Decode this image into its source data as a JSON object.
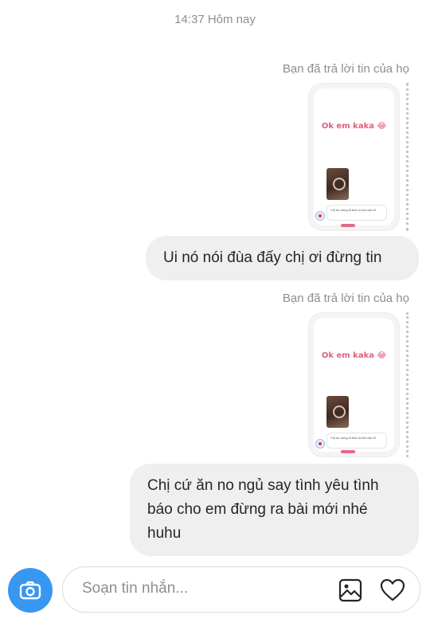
{
  "header": {
    "timestamp": "14:37 Hôm nay"
  },
  "messages": [
    {
      "reply_label": "Bạn đã trả lời tin của họ",
      "story": {
        "title": "Ok em kaka 😂",
        "caption": "Chị ăn uống đi thôi ra bài mới đi"
      },
      "text": "Ui nó nói đùa đấy chị ơi đừng tin"
    },
    {
      "reply_label": "Bạn đã trả lời tin của họ",
      "story": {
        "title": "Ok em kaka 😂",
        "caption": "Chị ăn uống đi thôi ra bài mới đi"
      },
      "text": "Chị cứ ăn no ngủ say tình yêu tình báo cho em đừng ra bài mới nhé huhu"
    }
  ],
  "composer": {
    "placeholder": "Soạn tin nhắn..."
  },
  "icons": {
    "camera": "camera-icon",
    "gallery": "gallery-icon",
    "heart": "heart-icon"
  },
  "colors": {
    "accent": "#3897f0",
    "bubble": "#efefef",
    "story_title": "#e0607e"
  }
}
